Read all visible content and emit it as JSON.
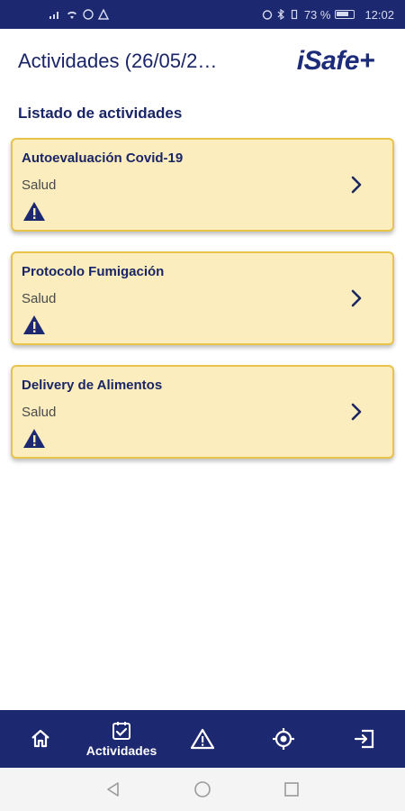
{
  "status_bar": {
    "battery": "73 %",
    "time": "12:02"
  },
  "header": {
    "title": "Actividades (26/05/2…",
    "logo": "iSafe+"
  },
  "list": {
    "label": "Listado de actividades",
    "items": [
      {
        "title": "Autoevaluación Covid-19",
        "category": "Salud",
        "icon": "warning-icon"
      },
      {
        "title": "Protocolo Fumigación",
        "category": "Salud",
        "icon": "warning-icon"
      },
      {
        "title": "Delivery de Alimentos",
        "category": "Salud",
        "icon": "warning-icon"
      }
    ]
  },
  "bottom_nav": {
    "items": [
      {
        "icon": "home-icon",
        "label": ""
      },
      {
        "icon": "checkbox-icon",
        "label": "Actividades"
      },
      {
        "icon": "warning-icon",
        "label": ""
      },
      {
        "icon": "target-icon",
        "label": ""
      },
      {
        "icon": "logout-icon",
        "label": ""
      }
    ]
  },
  "colors": {
    "primary": "#1c2870",
    "card_bg": "#fbedbd",
    "card_border": "#e8c34a"
  }
}
